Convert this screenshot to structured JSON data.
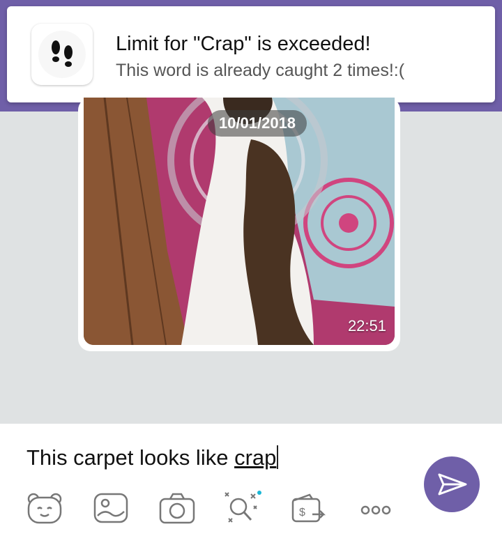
{
  "notification": {
    "app_icon": "footprints-icon",
    "title": "Limit for \"Crap\" is exceeded!",
    "body": "This word is already caught 2 times!:("
  },
  "chat": {
    "photo_date": "10/01/2018",
    "photo_time": "22:51"
  },
  "composer": {
    "message_prefix": "This carpet looks like ",
    "message_flagged_word": "crap",
    "send_icon": "send-icon",
    "tools": [
      {
        "icon": "sticker-bear-icon"
      },
      {
        "icon": "gallery-icon"
      },
      {
        "icon": "camera-icon"
      },
      {
        "icon": "games-doodle-icon"
      },
      {
        "icon": "money-transfer-icon"
      },
      {
        "icon": "more-icon"
      }
    ]
  },
  "colors": {
    "accent": "#6f5fa8",
    "chat_background": "#dfe2e3",
    "badge_dot": "#1ab7d6"
  }
}
